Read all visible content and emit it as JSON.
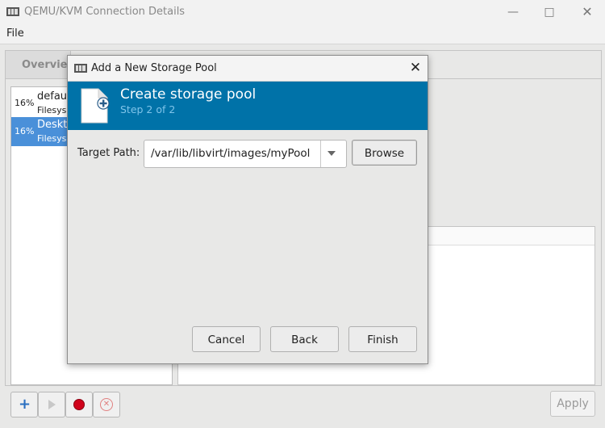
{
  "main_window": {
    "title": "QEMU/KVM Connection Details",
    "menu_file": "File",
    "tab_overview": "Overvie",
    "pools": [
      {
        "percent": "16%",
        "name": "defau",
        "type": "Filesys"
      },
      {
        "percent": "16%",
        "name": "Deskt",
        "type": "Filesys"
      }
    ],
    "apply_label": "Apply"
  },
  "dialog": {
    "title": "Add a New Storage Pool",
    "header_title": "Create storage pool",
    "header_step": "Step 2 of 2",
    "target_path_label": "Target Path:",
    "target_path_value": "/var/lib/libvirt/images/myPool",
    "browse_label": "Browse",
    "cancel_label": "Cancel",
    "back_label": "Back",
    "finish_label": "Finish"
  },
  "colors": {
    "header_bg": "#0072a8",
    "header_step": "#7fc4ea",
    "selection": "#4a90d9",
    "stop_red": "#d0021b"
  },
  "icons": {
    "app": "vm-monitor-icon",
    "header": "storage-document-add-icon",
    "add": "plus-icon",
    "start": "play-icon",
    "stop": "record-stop-icon",
    "delete": "delete-circle-icon"
  }
}
